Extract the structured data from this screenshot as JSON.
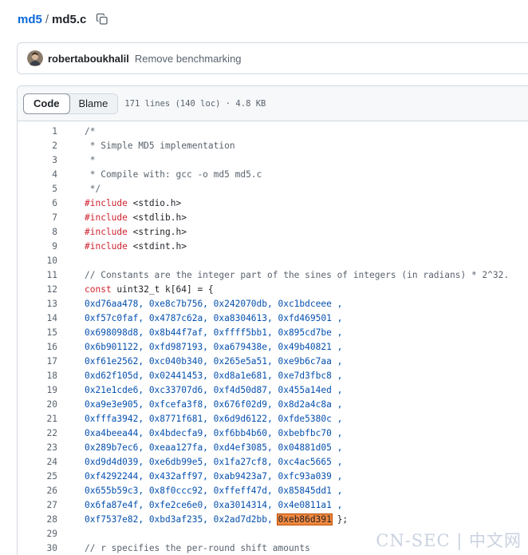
{
  "breadcrumb": {
    "repo": "md5",
    "separator": "/",
    "file": "md5.c"
  },
  "commit": {
    "author": "robertaboukhalil",
    "message": "Remove benchmarking"
  },
  "file_header": {
    "tabs": [
      {
        "label": "Code",
        "active": true
      },
      {
        "label": "Blame",
        "active": false
      }
    ],
    "meta": "171 lines (140 loc) · 4.8 KB"
  },
  "code_lines": [
    {
      "n": "1",
      "segments": [
        {
          "t": "/*",
          "c": "cm"
        }
      ]
    },
    {
      "n": "2",
      "segments": [
        {
          "t": " * Simple MD5 implementation",
          "c": "cm"
        }
      ]
    },
    {
      "n": "3",
      "segments": [
        {
          "t": " *",
          "c": "cm"
        }
      ]
    },
    {
      "n": "4",
      "segments": [
        {
          "t": " * Compile with: gcc -o md5 md5.c",
          "c": "cm"
        }
      ]
    },
    {
      "n": "5",
      "segments": [
        {
          "t": " */",
          "c": "cm"
        }
      ]
    },
    {
      "n": "6",
      "segments": [
        {
          "t": "#include",
          "c": "kw"
        },
        {
          "t": " <stdio.h>",
          "c": ""
        }
      ]
    },
    {
      "n": "7",
      "segments": [
        {
          "t": "#include",
          "c": "kw"
        },
        {
          "t": " <stdlib.h>",
          "c": ""
        }
      ]
    },
    {
      "n": "8",
      "segments": [
        {
          "t": "#include",
          "c": "kw"
        },
        {
          "t": " <string.h>",
          "c": ""
        }
      ]
    },
    {
      "n": "9",
      "segments": [
        {
          "t": "#include",
          "c": "kw"
        },
        {
          "t": " <stdint.h>",
          "c": ""
        }
      ]
    },
    {
      "n": "10",
      "segments": []
    },
    {
      "n": "11",
      "segments": [
        {
          "t": "// Constants are the integer part of the sines of integers (in radians) * 2^32.",
          "c": "cm"
        }
      ]
    },
    {
      "n": "12",
      "segments": [
        {
          "t": "const",
          "c": "kw"
        },
        {
          "t": " uint32_t k[64] = {",
          "c": ""
        }
      ]
    },
    {
      "n": "13",
      "segments": [
        {
          "t": "0xd76aa478, 0xe8c7b756, 0x242070db, 0xc1bdceee ,",
          "c": "hex"
        }
      ]
    },
    {
      "n": "14",
      "segments": [
        {
          "t": "0xf57c0faf, 0x4787c62a, 0xa8304613, 0xfd469501 ,",
          "c": "hex"
        }
      ]
    },
    {
      "n": "15",
      "segments": [
        {
          "t": "0x698098d8, 0x8b44f7af, 0xffff5bb1, 0x895cd7be ,",
          "c": "hex"
        }
      ]
    },
    {
      "n": "16",
      "segments": [
        {
          "t": "0x6b901122, 0xfd987193, 0xa679438e, 0x49b40821 ,",
          "c": "hex"
        }
      ]
    },
    {
      "n": "17",
      "segments": [
        {
          "t": "0xf61e2562, 0xc040b340, 0x265e5a51, 0xe9b6c7aa ,",
          "c": "hex"
        }
      ]
    },
    {
      "n": "18",
      "segments": [
        {
          "t": "0xd62f105d, 0x02441453, 0xd8a1e681, 0xe7d3fbc8 ,",
          "c": "hex"
        }
      ]
    },
    {
      "n": "19",
      "segments": [
        {
          "t": "0x21e1cde6, 0xc33707d6, 0xf4d50d87, 0x455a14ed ,",
          "c": "hex"
        }
      ]
    },
    {
      "n": "20",
      "segments": [
        {
          "t": "0xa9e3e905, 0xfcefa3f8, 0x676f02d9, 0x8d2a4c8a ,",
          "c": "hex"
        }
      ]
    },
    {
      "n": "21",
      "segments": [
        {
          "t": "0xfffa3942, 0x8771f681, 0x6d9d6122, 0xfde5380c ,",
          "c": "hex"
        }
      ]
    },
    {
      "n": "22",
      "segments": [
        {
          "t": "0xa4beea44, 0x4bdecfa9, 0xf6bb4b60, 0xbebfbc70 ,",
          "c": "hex"
        }
      ]
    },
    {
      "n": "23",
      "segments": [
        {
          "t": "0x289b7ec6, 0xeaa127fa, 0xd4ef3085, 0x04881d05 ,",
          "c": "hex"
        }
      ]
    },
    {
      "n": "24",
      "segments": [
        {
          "t": "0xd9d4d039, 0xe6db99e5, 0x1fa27cf8, 0xc4ac5665 ,",
          "c": "hex"
        }
      ]
    },
    {
      "n": "25",
      "segments": [
        {
          "t": "0xf4292244, 0x432aff97, 0xab9423a7, 0xfc93a039 ,",
          "c": "hex"
        }
      ]
    },
    {
      "n": "26",
      "segments": [
        {
          "t": "0x655b59c3, 0x8f0ccc92, 0xffeff47d, 0x85845dd1 ,",
          "c": "hex"
        }
      ]
    },
    {
      "n": "27",
      "segments": [
        {
          "t": "0x6fa87e4f, 0xfe2ce6e0, 0xa3014314, 0x4e0811a1 ,",
          "c": "hex"
        }
      ]
    },
    {
      "n": "28",
      "segments": [
        {
          "t": "0xf7537e82, 0xbd3af235, 0x2ad7d2bb, ",
          "c": "hex"
        },
        {
          "t": "0xeb86d391",
          "c": "hl"
        },
        {
          "t": " };",
          "c": ""
        }
      ]
    },
    {
      "n": "29",
      "segments": []
    },
    {
      "n": "30",
      "segments": [
        {
          "t": "// r specifies the per-round shift amounts",
          "c": "cm"
        }
      ]
    }
  ],
  "watermark": "CN-SEC | 中文网",
  "colors": {
    "link": "#0969da",
    "comment": "#59636e",
    "keyword": "#cf222e",
    "constant": "#0550ae",
    "highlight": "#f0883e"
  },
  "icons": {
    "copy": "copy-icon",
    "avatar": "avatar"
  }
}
